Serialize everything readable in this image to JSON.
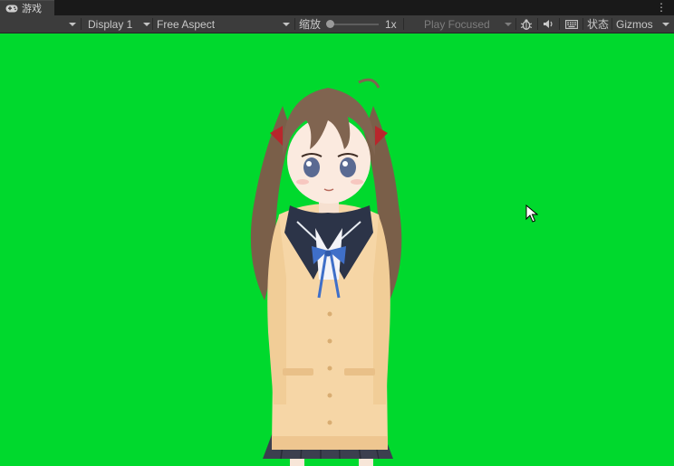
{
  "window": {
    "tab_title": "游戏",
    "tab_icon": "gamepad-icon",
    "menu_icon": "kebab-menu-icon"
  },
  "toolbar": {
    "display": "Display 1",
    "aspect": "Free Aspect",
    "scale_label": "缩放",
    "scale_value": "1x",
    "scale_fraction": 0.0,
    "play_mode": "Play Focused",
    "stats": "状态",
    "gizmos": "Gizmos",
    "icons": [
      "bug-icon",
      "speaker-icon",
      "keyboard-icon"
    ]
  },
  "viewport": {
    "background": "#00d92d"
  },
  "colors": {
    "toolbar": "#3c3c3c",
    "tabbar": "#191919",
    "greenscreen": "#00d92d"
  }
}
